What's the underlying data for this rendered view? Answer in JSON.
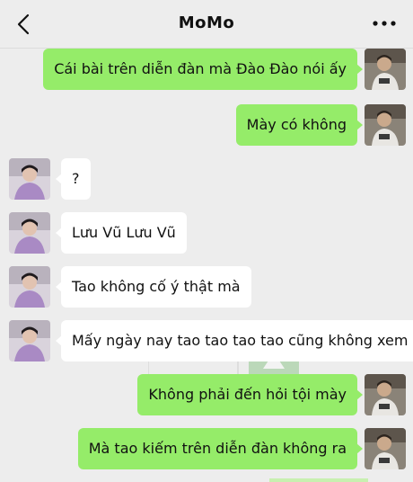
{
  "header": {
    "title": "MoMo",
    "back_icon": "chevron-left-icon",
    "more_icon": "more-dots-icon"
  },
  "colors": {
    "outgoing_bubble": "#95ec69",
    "incoming_bubble": "#ffffff",
    "background": "#ededed"
  },
  "messages": [
    {
      "direction": "out",
      "text": "Cái bài trên diễn đàn mà Đào Đào nói ấy"
    },
    {
      "direction": "out",
      "text": "Mày có không"
    },
    {
      "direction": "in",
      "text": "?"
    },
    {
      "direction": "in",
      "text": "Lưu Vũ Lưu Vũ"
    },
    {
      "direction": "in",
      "text": "Tao không cố ý thật mà"
    },
    {
      "direction": "in",
      "text": "Mấy ngày nay tao tao tao tao cũng không xem"
    },
    {
      "direction": "out",
      "text": "Không phải đến hỏi tội mày"
    },
    {
      "direction": "out",
      "text": "Mà tao kiếm trên diễn đàn không ra"
    }
  ]
}
